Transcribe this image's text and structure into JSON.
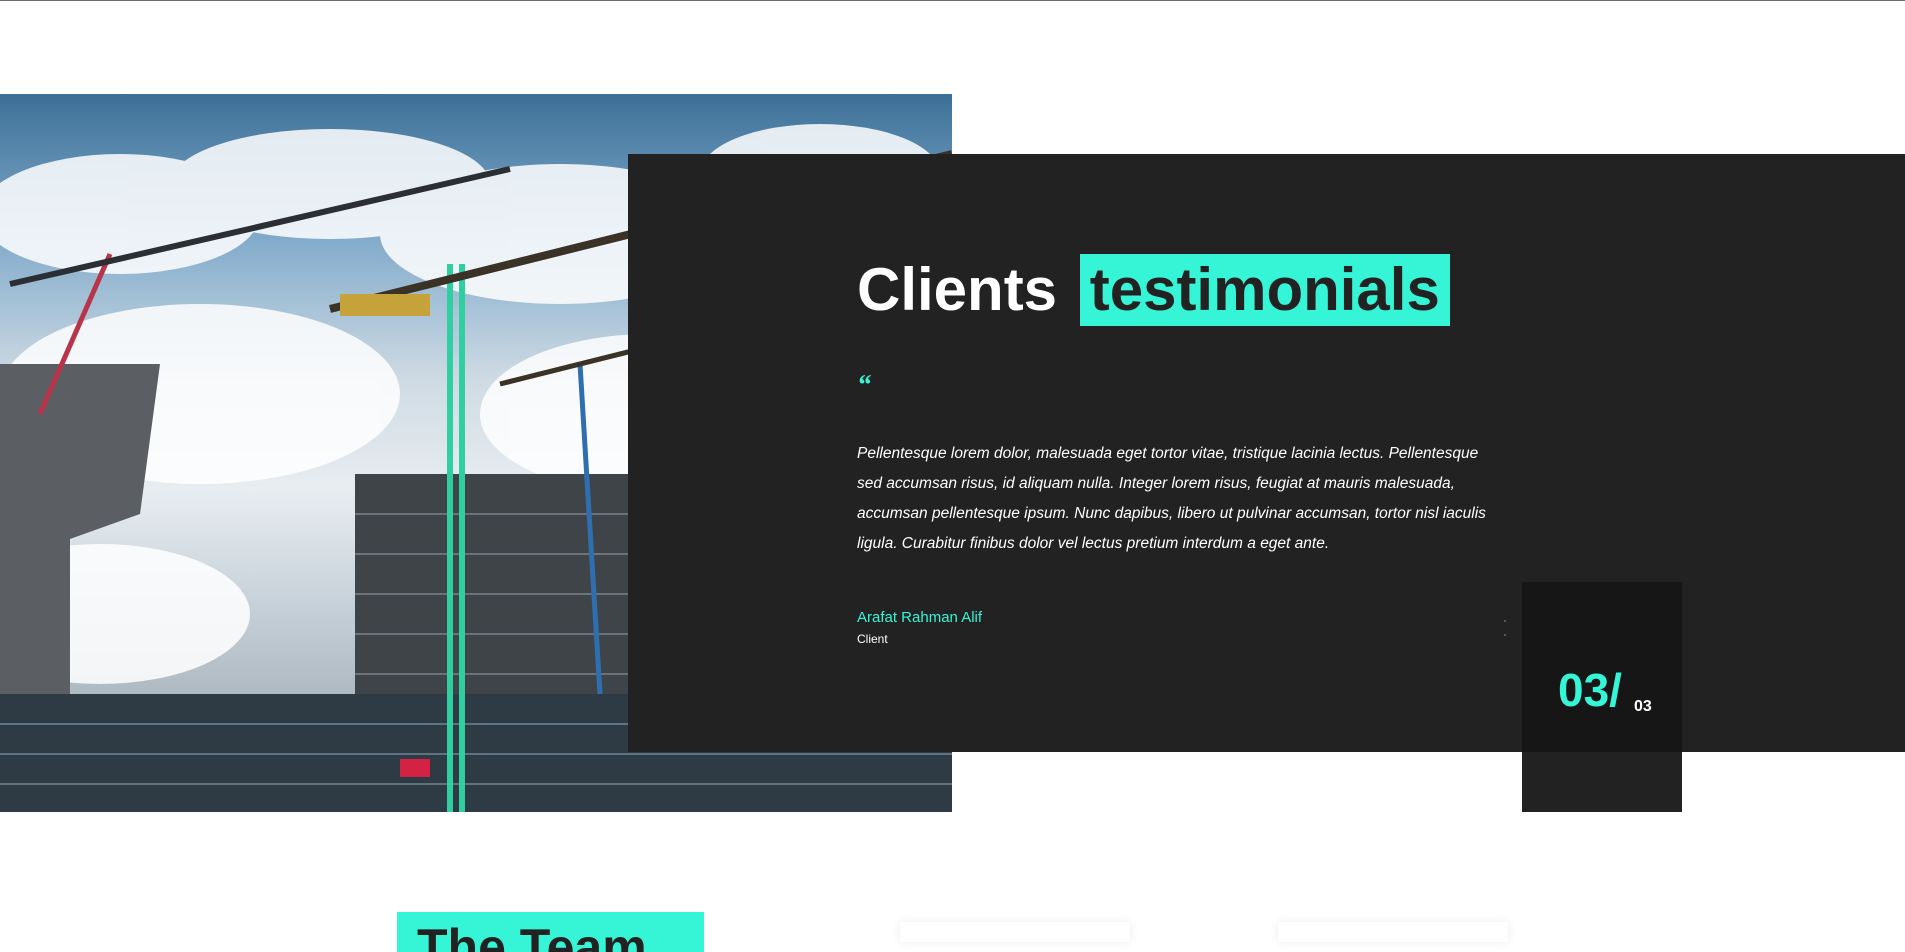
{
  "section": {
    "title_plain": "Clients",
    "title_highlight": "testimonials",
    "quote_mark": "“",
    "quote_text": "Pellentesque lorem dolor, malesuada eget tortor vitae, tristique lacinia lectus. Pellentesque sed accumsan risus, id aliquam nulla. Integer lorem risus, feugiat at mauris malesuada, accumsan pellentesque ipsum. Nunc dapibus, libero ut pulvinar accumsan, tortor nisl iaculis ligula. Curabitur finibus dolor vel lectus pretium interdum a eget ante.",
    "author_name": "Arafat Rahman Alif",
    "author_role": "Client"
  },
  "counter": {
    "current": "03/",
    "total": "03"
  },
  "next_section": {
    "title_partial": "The Team"
  },
  "colors": {
    "accent": "#36f5d6",
    "panel": "#222222",
    "counter_bg": "#161616"
  },
  "icons": {
    "photo": "construction-cranes-image"
  }
}
